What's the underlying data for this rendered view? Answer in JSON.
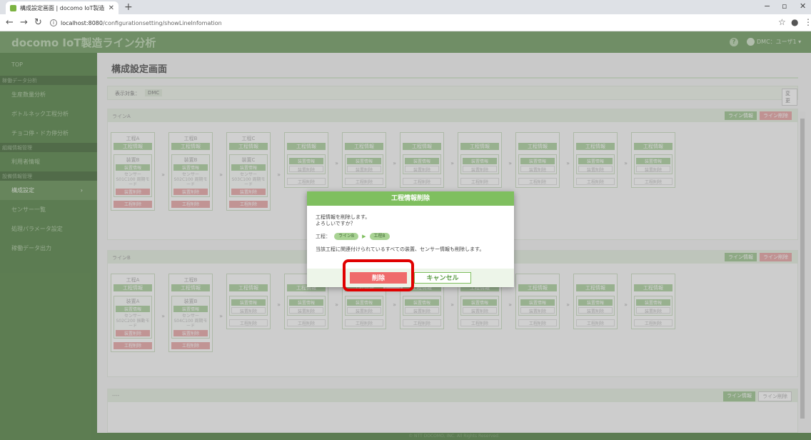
{
  "browser": {
    "tab_title": "構成設定画面 | docomo IoT製造",
    "url_host": "localhost:8080",
    "url_path": "/configurationsetting/showLineInfomation",
    "minimize": "−",
    "restore": "▫",
    "close": "✕"
  },
  "header": {
    "app_title": "docomo IoT製造ライン分析",
    "help": "?",
    "user": "DMC：ユーザ1 ▾"
  },
  "sidebar": {
    "top": "TOP",
    "group_analysis": "稼働データ分析",
    "production_analysis": "生産数量分析",
    "bottleneck_analysis": "ボトルネック工程分析",
    "chokotei_analysis": "チョコ停・ドカ停分析",
    "group_org": "組織情報管理",
    "user_info": "利用者情報",
    "group_equipment": "設備情報管理",
    "config_setting": "構成設定",
    "sensor_list": "センサー一覧",
    "processing_params": "処理パラメータ設定",
    "data_export": "稼働データ出力"
  },
  "main": {
    "page_title": "構成設定画面",
    "target_label": "表示対象：",
    "target_value": "DMC",
    "change_button": "変更"
  },
  "lines": {
    "a": {
      "name": "ラインA",
      "info_btn": "ライン情報",
      "del_btn": "ライン削除"
    },
    "b": {
      "name": "ラインB",
      "info_btn": "ライン情報",
      "del_btn": "ライン削除"
    },
    "c": {
      "name": "----",
      "info_btn": "ライン情報",
      "del_btn": "ライン削除"
    }
  },
  "labels": {
    "process_info": "工程情報",
    "device_info": "装置情報",
    "device_delete": "装置削除",
    "process_delete": "工程削除"
  },
  "line_a_processes": [
    {
      "name": "工程A",
      "device": "装置B",
      "sensor": "センサー S01C100 周期モード"
    },
    {
      "name": "工程B",
      "device": "装置B",
      "sensor": "センサー S02C100 周期モード"
    },
    {
      "name": "工程C",
      "device": "装置C",
      "sensor": "センサー S03C100 周期モード"
    }
  ],
  "line_b_processes": [
    {
      "name": "工程A",
      "device": "装置A",
      "sensor": "センサー S02C200 振動モード"
    },
    {
      "name": "工程B",
      "device": "装置B",
      "sensor": "センサー S04C100 周期モード"
    }
  ],
  "footer": "© NTT DOCOMO, INC. All Rights Reserved.",
  "modal": {
    "title": "工程情報削除",
    "message_1": "工程情報を削除します。",
    "message_2": "よろしいですか？",
    "process_label": "工程：",
    "line_pill": "ラインB",
    "process_pill": "工程B",
    "warning": "当該工程に関連付けられているすべての装置、センサー情報も削除します。",
    "delete_button": "削除",
    "cancel_button": "キャンセル"
  },
  "colors": {
    "brand": "#6c9a5c",
    "modal_header": "#7fbf5f",
    "delete": "#ef6b6b",
    "highlight": "#e00000"
  }
}
